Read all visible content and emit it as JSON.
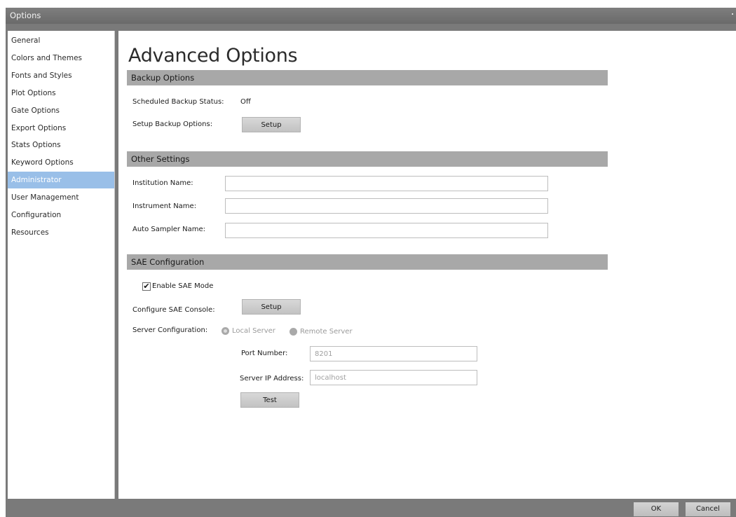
{
  "window": {
    "title": "Options"
  },
  "sidebar": {
    "items": [
      {
        "label": "General"
      },
      {
        "label": "Colors and Themes"
      },
      {
        "label": "Fonts and Styles"
      },
      {
        "label": "Plot Options"
      },
      {
        "label": "Gate Options"
      },
      {
        "label": "Export Options"
      },
      {
        "label": "Stats Options"
      },
      {
        "label": "Keyword Options"
      },
      {
        "label": "Administrator",
        "selected": true
      },
      {
        "label": "User Management"
      },
      {
        "label": "Configuration"
      },
      {
        "label": "Resources"
      }
    ]
  },
  "main": {
    "title": "Advanced Options",
    "backup": {
      "header": "Backup Options",
      "status_label": "Scheduled Backup Status:",
      "status_value": "Off",
      "setup_label": "Setup Backup Options:",
      "setup_button": "Setup"
    },
    "other": {
      "header": "Other Settings",
      "institution_label": "Institution Name:",
      "institution_value": "",
      "instrument_label": "Instrument Name:",
      "instrument_value": "",
      "autosampler_label": "Auto Sampler Name:",
      "autosampler_value": ""
    },
    "sae": {
      "header": "SAE Configuration",
      "enable_label": "Enable SAE Mode",
      "enable_checked": true,
      "console_label": "Configure SAE Console:",
      "console_button": "Setup",
      "server_config_label": "Server Configuration:",
      "local_server_label": "Local Server",
      "remote_server_label": "Remote Server",
      "selected_server": "Local Server",
      "port_label": "Port Number:",
      "port_value": "8201",
      "ip_label": "Server IP Address:",
      "ip_value": "localhost",
      "test_button": "Test"
    }
  },
  "footer": {
    "ok": "OK",
    "cancel": "Cancel"
  },
  "colors": {
    "titlebar": "#707070",
    "section_header": "#a8a8a8",
    "selected_item": "#99bfe8"
  }
}
